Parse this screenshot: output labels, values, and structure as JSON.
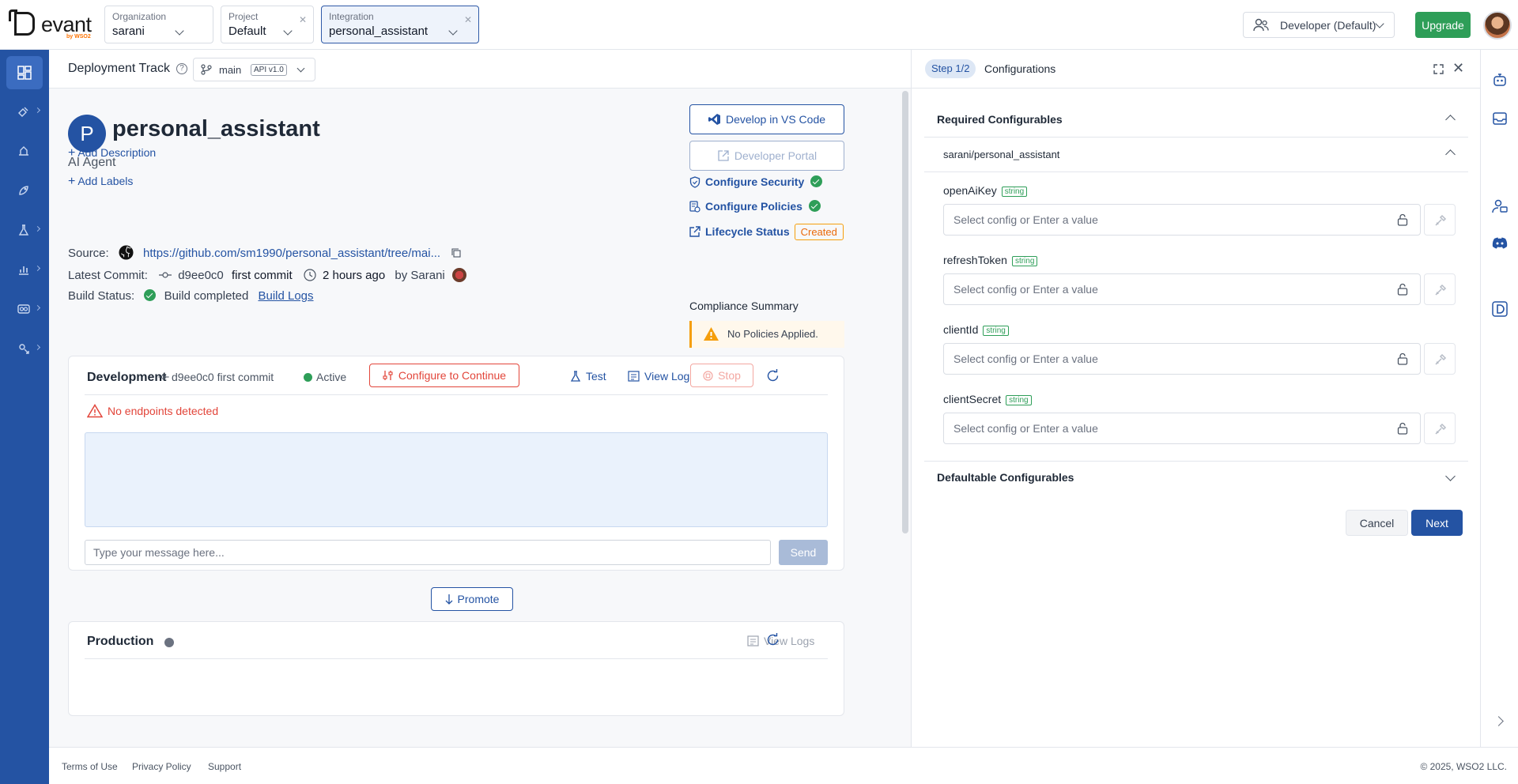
{
  "topbar": {
    "logo_text": "evant",
    "logo_sub": "by WSO2",
    "organization": {
      "label": "Organization",
      "value": "sarani"
    },
    "project": {
      "label": "Project",
      "value": "Default"
    },
    "integration": {
      "label": "Integration",
      "value": "personal_assistant"
    },
    "role": "Developer (Default)",
    "upgrade_label": "Upgrade"
  },
  "track": {
    "title": "Deployment Track",
    "help": "?",
    "branch": "main",
    "api_version": "API v1.0"
  },
  "component": {
    "initial": "P",
    "name": "personal_assistant",
    "type": "AI Agent",
    "add_description": "Add Description",
    "add_labels": "Add Labels",
    "source_label": "Source:",
    "source_url": "https://github.com/sm1990/personal_assistant/tree/mai...",
    "latest_commit_label": "Latest Commit:",
    "commit_hash": "d9ee0c0",
    "commit_message": "first commit",
    "commit_time": "2 hours ago",
    "commit_author": "by Sarani",
    "build_status_label": "Build Status:",
    "build_status": "Build completed",
    "build_logs": "Build Logs"
  },
  "actions": {
    "vscode": "Develop in VS Code",
    "portal": "Developer Portal",
    "security": "Configure Security",
    "policies": "Configure Policies",
    "lifecycle": "Lifecycle Status",
    "lifecycle_status": "Created",
    "compliance_title": "Compliance Summary",
    "compliance_msg": "No Policies Applied."
  },
  "development": {
    "title": "Development",
    "commit": "d9ee0c0 first commit",
    "status": "Active",
    "configure": "Configure to Continue",
    "test": "Test",
    "view_logs": "View Logs",
    "stop": "Stop",
    "no_endpoints": "No endpoints detected",
    "chat_placeholder": "Type your message here...",
    "send": "Send"
  },
  "promote_label": "Promote",
  "production": {
    "title": "Production",
    "view_logs": "View Logs"
  },
  "footer": {
    "terms": "Terms of Use",
    "privacy": "Privacy Policy",
    "support": "Support",
    "copyright": "© 2025, WSO2 LLC."
  },
  "panel": {
    "step": "Step 1/2",
    "title": "Configurations",
    "required_title": "Required Configurables",
    "module": "sarani/personal_assistant",
    "fields": [
      {
        "name": "openAiKey",
        "type": "string",
        "placeholder": "Select config or Enter a value"
      },
      {
        "name": "refreshToken",
        "type": "string",
        "placeholder": "Select config or Enter a value"
      },
      {
        "name": "clientId",
        "type": "string",
        "placeholder": "Select config or Enter a value"
      },
      {
        "name": "clientSecret",
        "type": "string",
        "placeholder": "Select config or Enter a value"
      }
    ],
    "defaultable_title": "Defaultable Configurables",
    "cancel": "Cancel",
    "next": "Next"
  },
  "colors": {
    "nav_bg": "#2453a3",
    "primary": "#2453a3",
    "success": "#2e9e58",
    "danger": "#e2453a",
    "warning": "#f59e0b"
  }
}
